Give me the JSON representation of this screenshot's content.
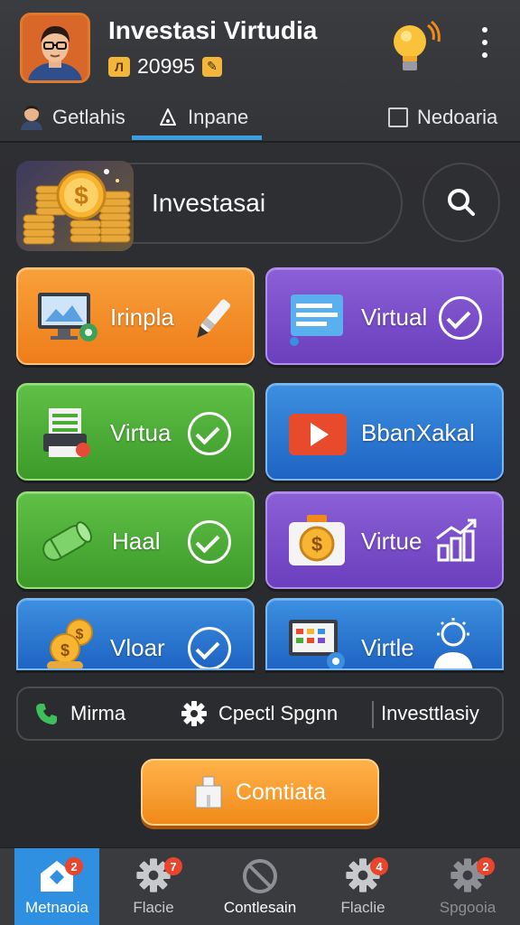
{
  "header": {
    "title": "Investasi Virtudia",
    "coin_symbol": "Л",
    "coin_value": "20995",
    "edit_symbol": "✎"
  },
  "tabs": [
    {
      "label": "Getlahis"
    },
    {
      "label": "Inpane"
    },
    {
      "label": "Nedoaria"
    }
  ],
  "hero": {
    "label": "Investasai"
  },
  "tiles": [
    {
      "label": "Irinpla"
    },
    {
      "label": "Virtual"
    },
    {
      "label": "Virtua"
    },
    {
      "label": "BbanXakal"
    },
    {
      "label": "Haal"
    },
    {
      "label": "Virtue"
    },
    {
      "label": "Vloar"
    },
    {
      "label": "Virtle"
    }
  ],
  "actions": [
    {
      "label": "Mirma"
    },
    {
      "label": "Cpectl Spgnn"
    },
    {
      "label": "Investtlasiy"
    }
  ],
  "cta": {
    "label": "Comtiata"
  },
  "bottom_nav": [
    {
      "label": "Metnaoia",
      "badge": "2"
    },
    {
      "label": "Flacie",
      "badge": "7"
    },
    {
      "label": "Contlesain"
    },
    {
      "label": "Flaclie",
      "badge": "4"
    },
    {
      "label": "Spgooia",
      "badge": "2"
    }
  ],
  "colors": {
    "accent": "#3a9ee0",
    "orange": "#f08a1a",
    "purple": "#7a4ccb",
    "green": "#4aab36",
    "blue": "#2b78d4",
    "badge": "#e8452c"
  },
  "icons": [
    "avatar",
    "coin-icon",
    "edit-icon",
    "lightbulb-icon",
    "kebab-icon",
    "search-icon",
    "phone-icon",
    "gear-icon",
    "home-icon",
    "block-icon"
  ]
}
